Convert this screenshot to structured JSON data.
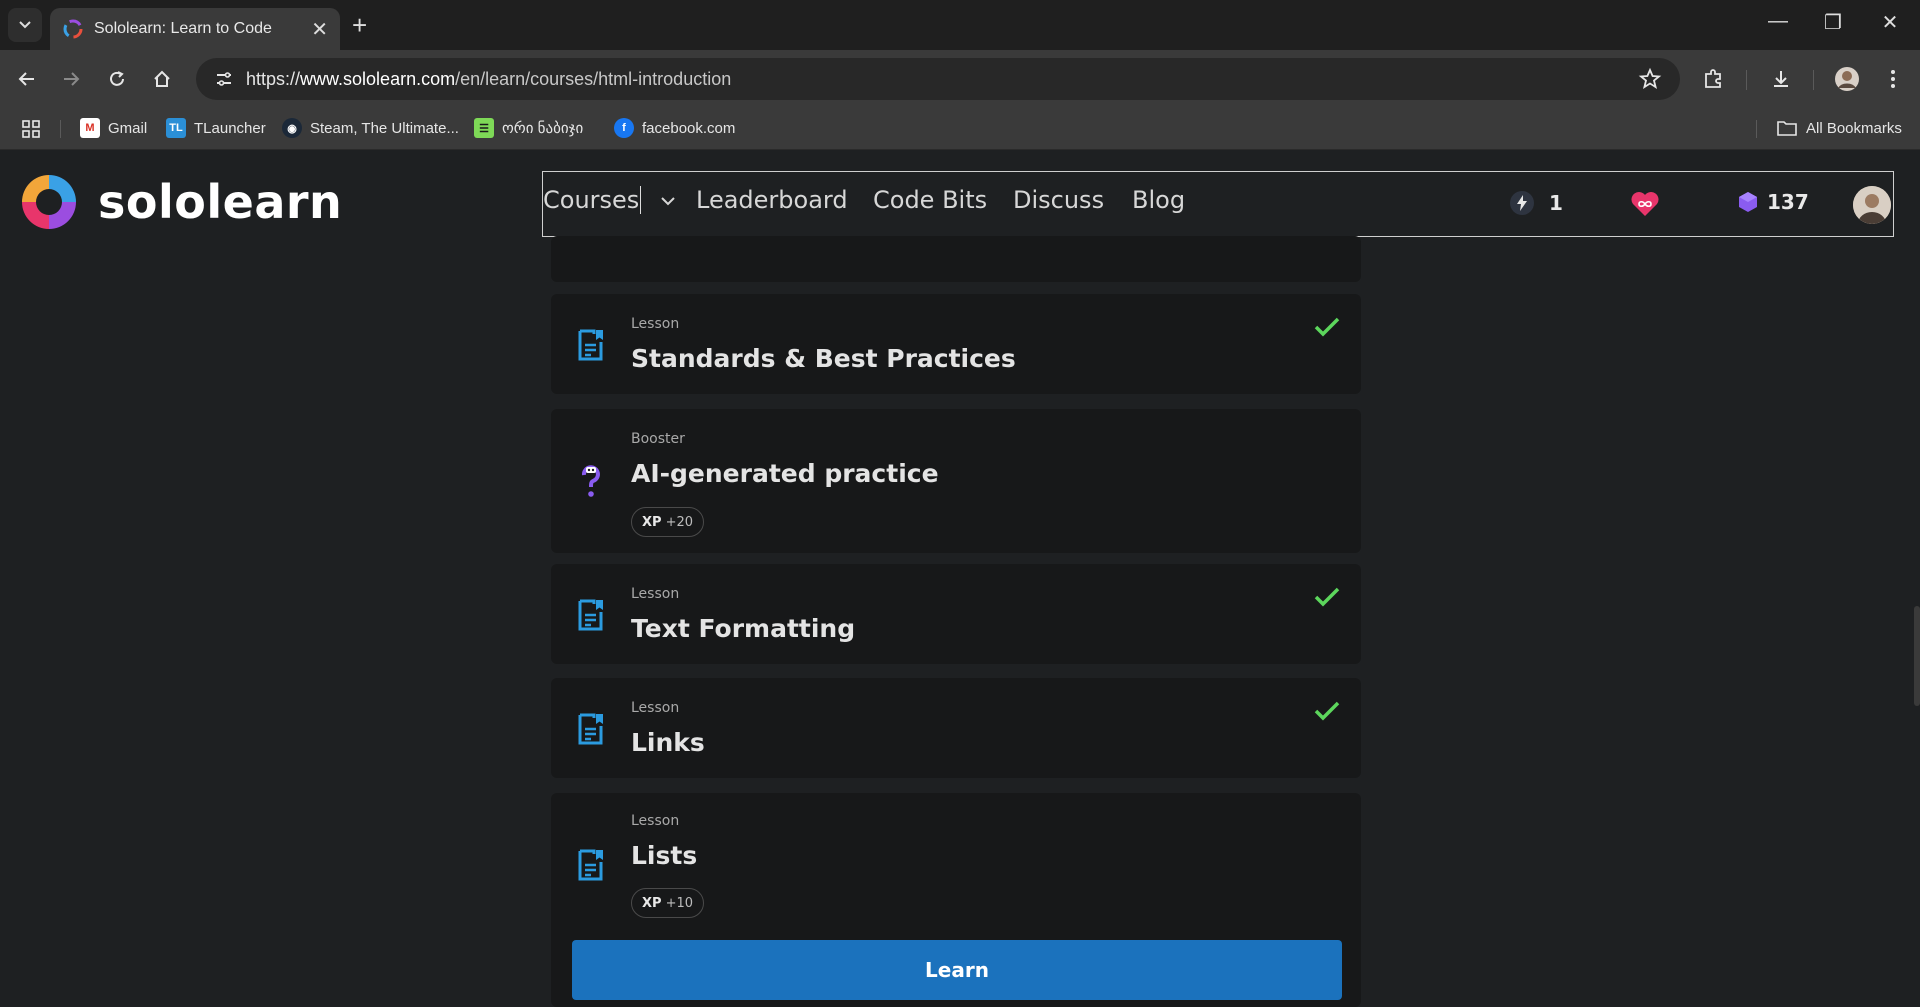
{
  "browser": {
    "tab_title": "Sololearn: Learn to Code",
    "url_scheme": "https://",
    "url_host": "www.sololearn.com",
    "url_path": "/en/learn/courses/html-introduction",
    "bookmarks": [
      {
        "label": "Gmail",
        "icon": "gmail-icon"
      },
      {
        "label": "TLauncher",
        "icon": "tlauncher-icon"
      },
      {
        "label": "Steam, The Ultimate...",
        "icon": "steam-icon"
      },
      {
        "label": "ორი ნაბიჯი",
        "icon": "bookmark-site-icon"
      },
      {
        "label": "facebook.com",
        "icon": "facebook-icon"
      }
    ],
    "all_bookmarks_label": "All Bookmarks"
  },
  "sololearn": {
    "logo_text": "sololearn",
    "nav": {
      "courses": "Courses",
      "leaderboard": "Leaderboard",
      "code_bits": "Code Bits",
      "discuss": "Discuss",
      "blog": "Blog"
    },
    "streak": "1",
    "gems": "137",
    "colors": {
      "accent_blue": "#1b72bd",
      "check_green": "#5cd65c",
      "heart": "#e8356b",
      "gem": "#8a5cf0"
    }
  },
  "lessons": [
    {
      "type": "",
      "title": "",
      "completed": false
    },
    {
      "type": "Lesson",
      "title": "Standards & Best Practices",
      "completed": true,
      "icon": "lesson-doc-icon"
    },
    {
      "type": "Booster",
      "title": "AI-generated practice",
      "completed": false,
      "xp_label": "XP",
      "xp_value": "+20",
      "icon": "question-robot-icon"
    },
    {
      "type": "Lesson",
      "title": "Text Formatting",
      "completed": true,
      "icon": "lesson-doc-icon"
    },
    {
      "type": "Lesson",
      "title": "Links",
      "completed": true,
      "icon": "lesson-doc-icon"
    },
    {
      "type": "Lesson",
      "title": "Lists",
      "completed": false,
      "xp_label": "XP",
      "xp_value": "+10",
      "icon": "lesson-doc-icon"
    }
  ],
  "learn_button": "Learn"
}
